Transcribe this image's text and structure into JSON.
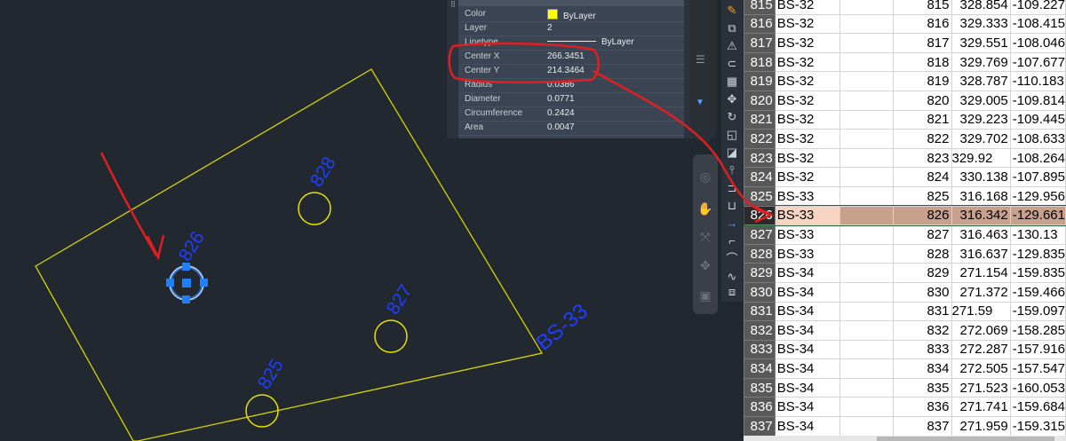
{
  "properties_panel": {
    "rows": [
      {
        "key": "Color",
        "value": "ByLayer",
        "kind": "color"
      },
      {
        "key": "Layer",
        "value": "2"
      },
      {
        "key": "Linetype",
        "value": "ByLayer",
        "kind": "linetype"
      },
      {
        "key": "Center X",
        "value": "266.3451"
      },
      {
        "key": "Center Y",
        "value": "214.3464"
      },
      {
        "key": "Radius",
        "value": "0.0386"
      },
      {
        "key": "Diameter",
        "value": "0.0771"
      },
      {
        "key": "Circumference",
        "value": "0.2424"
      },
      {
        "key": "Area",
        "value": "0.0047"
      }
    ]
  },
  "drawing": {
    "point_labels": [
      "826",
      "828",
      "827",
      "825"
    ],
    "boundary_label": "BS-33",
    "colors": {
      "boundary": "#d8d300",
      "circle": "#e8e200",
      "label": "#1f3fff",
      "grip": "#1e7fff",
      "annotation": "#e02020",
      "background": "#212830"
    }
  },
  "spreadsheet": {
    "rows": [
      {
        "row": "815",
        "a": "BS-32",
        "b": "",
        "c": "815",
        "d": "328.854",
        "e": "-109.227"
      },
      {
        "row": "816",
        "a": "BS-32",
        "b": "",
        "c": "816",
        "d": "329.333",
        "e": "-108.415"
      },
      {
        "row": "817",
        "a": "BS-32",
        "b": "",
        "c": "817",
        "d": "329.551",
        "e": "-108.046"
      },
      {
        "row": "818",
        "a": "BS-32",
        "b": "",
        "c": "818",
        "d": "329.769",
        "e": "-107.677"
      },
      {
        "row": "819",
        "a": "BS-32",
        "b": "",
        "c": "819",
        "d": "328.787",
        "e": "-110.183"
      },
      {
        "row": "820",
        "a": "BS-32",
        "b": "",
        "c": "820",
        "d": "329.005",
        "e": "-109.814"
      },
      {
        "row": "821",
        "a": "BS-32",
        "b": "",
        "c": "821",
        "d": "329.223",
        "e": "-109.445"
      },
      {
        "row": "822",
        "a": "BS-32",
        "b": "",
        "c": "822",
        "d": "329.702",
        "e": "-108.633"
      },
      {
        "row": "823",
        "a": "BS-32",
        "b": "",
        "c": "823",
        "d": "329.92",
        "e": "-108.264",
        "d_left": true
      },
      {
        "row": "824",
        "a": "BS-32",
        "b": "",
        "c": "824",
        "d": "330.138",
        "e": "-107.895"
      },
      {
        "row": "825",
        "a": "BS-33",
        "b": "",
        "c": "825",
        "d": "316.168",
        "e": "-129.956"
      },
      {
        "row": "826",
        "a": "BS-33",
        "b": "",
        "c": "826",
        "d": "316.342",
        "e": "-129.661",
        "selected": true
      },
      {
        "row": "827",
        "a": "BS-33",
        "b": "",
        "c": "827",
        "d": "316.463",
        "e": "-130.13",
        "e_left": true
      },
      {
        "row": "828",
        "a": "BS-33",
        "b": "",
        "c": "828",
        "d": "316.637",
        "e": "-129.835"
      },
      {
        "row": "829",
        "a": "BS-34",
        "b": "",
        "c": "829",
        "d": "271.154",
        "e": "-159.835"
      },
      {
        "row": "830",
        "a": "BS-34",
        "b": "",
        "c": "830",
        "d": "271.372",
        "e": "-159.466"
      },
      {
        "row": "831",
        "a": "BS-34",
        "b": "",
        "c": "831",
        "d": "271.59",
        "e": "-159.097",
        "d_left": true
      },
      {
        "row": "832",
        "a": "BS-34",
        "b": "",
        "c": "832",
        "d": "272.069",
        "e": "-158.285"
      },
      {
        "row": "833",
        "a": "BS-34",
        "b": "",
        "c": "833",
        "d": "272.287",
        "e": "-157.916"
      },
      {
        "row": "834",
        "a": "BS-34",
        "b": "",
        "c": "834",
        "d": "272.505",
        "e": "-157.547"
      },
      {
        "row": "835",
        "a": "BS-34",
        "b": "",
        "c": "835",
        "d": "271.523",
        "e": "-160.053"
      },
      {
        "row": "836",
        "a": "BS-34",
        "b": "",
        "c": "836",
        "d": "271.741",
        "e": "-159.684"
      },
      {
        "row": "837",
        "a": "BS-34",
        "b": "",
        "c": "837",
        "d": "271.959",
        "e": "-159.315"
      }
    ],
    "colors": {
      "selected_row": "#c8a08e",
      "selected_cell": "#f6d4c2",
      "row_header": "#595959"
    }
  },
  "toolbar": {
    "icons": [
      "pencil-icon",
      "copy-icon",
      "mirror-icon",
      "offset-icon",
      "array-icon",
      "move-icon",
      "rotate-icon",
      "scale-icon",
      "stretch-icon",
      "trim-icon",
      "extend-icon",
      "break-icon",
      "join-icon",
      "chamfer-icon",
      "fillet-icon",
      "blend-icon",
      "explode-icon"
    ]
  },
  "navbar": {
    "icons": [
      "steering-wheel-icon",
      "pan-icon",
      "zoom-icon",
      "orbit-icon",
      "showmotion-icon"
    ]
  }
}
